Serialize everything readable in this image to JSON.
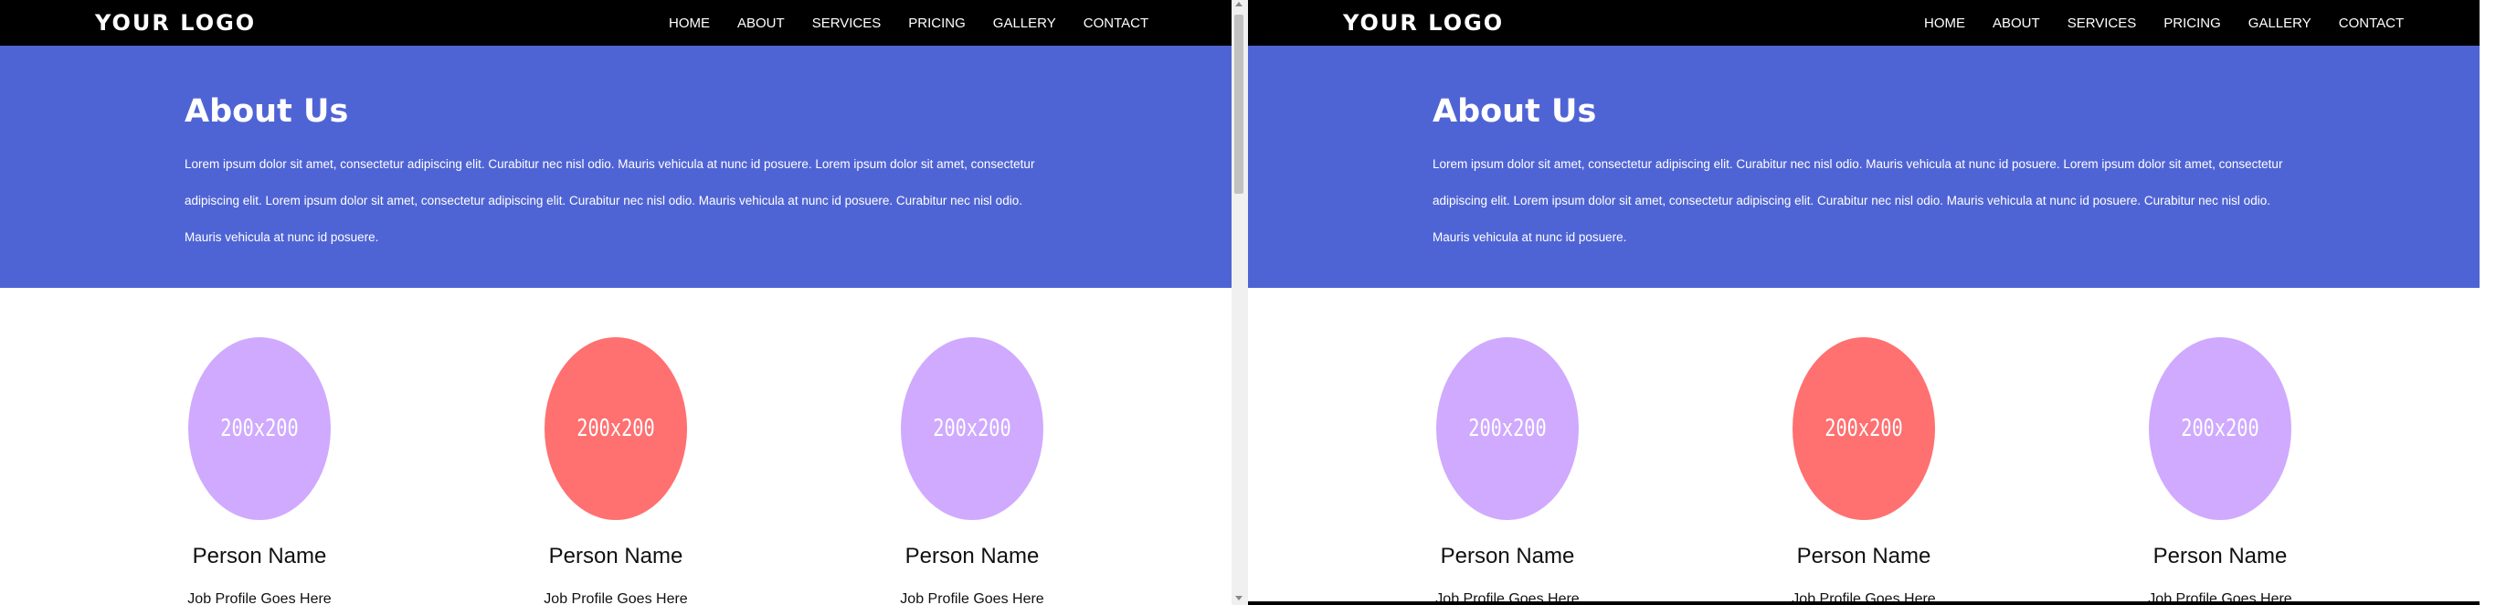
{
  "site": {
    "logo": "YOUR LOGO",
    "nav": [
      "HOME",
      "ABOUT",
      "SERVICES",
      "PRICING",
      "GALLERY",
      "CONTACT"
    ]
  },
  "hero": {
    "title": "About Us",
    "text": "Lorem ipsum dolor sit amet, consectetur adipiscing elit. Curabitur nec nisl odio. Mauris vehicula at nunc id posuere. Lorem ipsum dolor sit amet, consectetur adipiscing elit. Lorem ipsum dolor sit amet, consectetur adipiscing elit. Curabitur nec nisl odio. Mauris vehicula at nunc id posuere. Curabitur nec nisl odio. Mauris vehicula at nunc id posuere."
  },
  "team": [
    {
      "avatar": "200x200",
      "name": "Person Name",
      "job": "Job Profile Goes Here",
      "color": "#cfaaff"
    },
    {
      "avatar": "200x200",
      "name": "Person Name",
      "job": "Job Profile Goes Here",
      "color": "#ff7070"
    },
    {
      "avatar": "200x200",
      "name": "Person Name",
      "job": "Job Profile Goes Here",
      "color": "#cfaaff"
    }
  ],
  "colors": {
    "navbar": "#000000",
    "hero": "#4f64d4",
    "avatar_purple": "#cfaaff",
    "avatar_red": "#ff7070"
  }
}
